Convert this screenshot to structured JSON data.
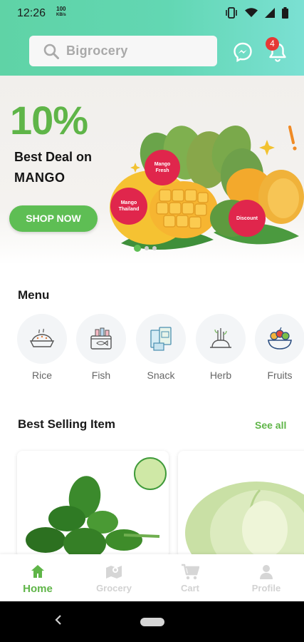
{
  "status_bar": {
    "time": "12:26",
    "speed_value": "100",
    "speed_unit": "KB/s"
  },
  "header": {
    "search_placeholder": "Bigrocery",
    "notification_count": "4",
    "icons": {
      "search": "search-icon",
      "messenger": "messenger-icon",
      "bell": "bell-icon"
    }
  },
  "banner": {
    "discount": "10%",
    "line1": "Best Deal on",
    "line2": "MANGO",
    "cta": "SHOP NOW",
    "tags": {
      "fresh": "Mango Fresh",
      "thailand": "Mango Thailand",
      "discount": "Discount"
    },
    "slide_count": 3,
    "active_slide": 1
  },
  "menu": {
    "title": "Menu",
    "items": [
      {
        "label": "Rice",
        "icon": "rice-icon"
      },
      {
        "label": "Fish",
        "icon": "fish-icon"
      },
      {
        "label": "Snack",
        "icon": "snack-icon"
      },
      {
        "label": "Herb",
        "icon": "herb-icon"
      },
      {
        "label": "Fruits",
        "icon": "fruits-icon"
      }
    ]
  },
  "best_selling": {
    "title": "Best Selling Item",
    "see_all": "See all"
  },
  "bottom_nav": {
    "items": [
      {
        "label": "Home",
        "icon": "home-icon",
        "active": true
      },
      {
        "label": "Grocery",
        "icon": "map-icon"
      },
      {
        "label": "Cart",
        "icon": "cart-icon"
      },
      {
        "label": "Profile",
        "icon": "profile-icon"
      }
    ]
  },
  "colors": {
    "brand_green": "#5fb548",
    "header_start": "#5fd3a6",
    "header_end": "#7be0d3",
    "badge_red": "#e53935",
    "tag_red": "#e0264c"
  }
}
